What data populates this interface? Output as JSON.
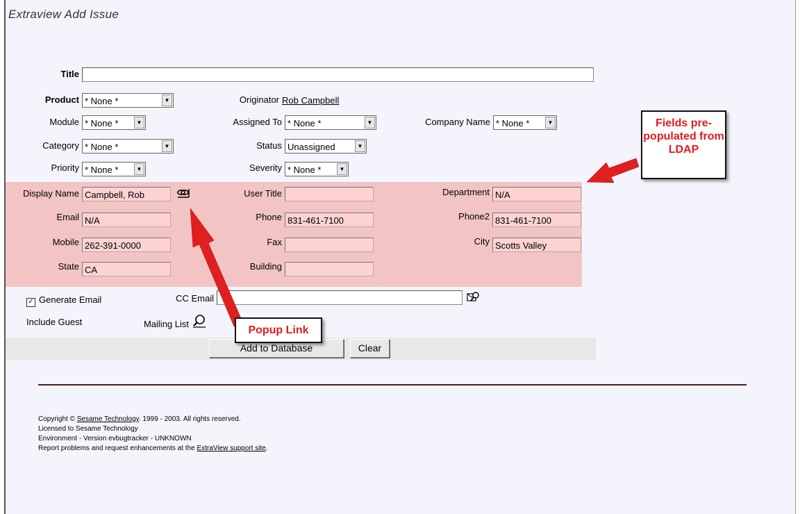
{
  "page_title": "Extraview Add Issue",
  "form": {
    "title_label": "Title",
    "product_label": "Product",
    "product_value": "* None *",
    "module_label": "Module",
    "module_value": "* None *",
    "category_label": "Category",
    "category_value": "* None *",
    "priority_label": "Priority",
    "priority_value": "* None *",
    "originator_label": "Originator",
    "originator_value": "Rob Campbell",
    "assigned_label": "Assigned To",
    "assigned_value": "* None *",
    "status_label": "Status",
    "status_value": "Unassigned",
    "severity_label": "Severity",
    "severity_value": "* None *",
    "company_label": "Company Name",
    "company_value": "* None *"
  },
  "ldap": {
    "display_name_label": "Display Name",
    "display_name_value": "Campbell, Rob",
    "email_label": "Email",
    "email_value": "N/A",
    "mobile_label": "Mobile",
    "mobile_value": "262-391-0000",
    "state_label": "State",
    "state_value": "CA",
    "user_title_label": "User Title",
    "user_title_value": "",
    "phone_label": "Phone",
    "phone_value": "831-461-7100",
    "fax_label": "Fax",
    "fax_value": "",
    "building_label": "Building",
    "building_value": "",
    "department_label": "Department",
    "department_value": "N/A",
    "phone2_label": "Phone2",
    "phone2_value": "831-461-7100",
    "city_label": "City",
    "city_value": "Scotts Valley"
  },
  "email": {
    "generate_label": "Generate Email",
    "generate_checked": true,
    "cc_label": "CC Email",
    "include_guest_label": "Include Guest",
    "mailing_list_label": "Mailing List"
  },
  "buttons": {
    "add_label": "Add to Database",
    "clear_label": "Clear"
  },
  "callouts": {
    "ldap_note": "Fields pre-populated from LDAP",
    "popup_note": "Popup Link"
  },
  "footer": {
    "copyright_prefix": "Copyright © ",
    "company_link": "Sesame Technology",
    "copyright_suffix": ". 1999 - 2003.  All rights reserved.",
    "licensed": "Licensed to Sesame Technology",
    "environment": "Environment - Version evbugtracker - UNKNOWN",
    "report_prefix": "Report problems and request enhancements at the ",
    "support_link": "ExtraView support site",
    "report_suffix": "."
  },
  "colors": {
    "ldap_highlight": "#f3c4c4",
    "callout_text": "#e41b1b",
    "arrow": "#e02020"
  }
}
